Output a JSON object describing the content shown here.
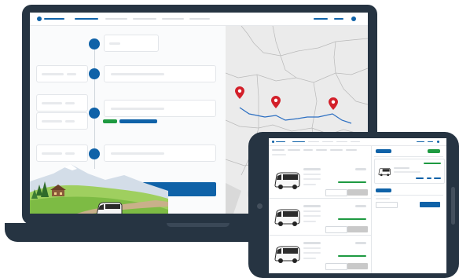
{
  "colors": {
    "accent": "#0f62a8",
    "success": "#1e9a41",
    "route_pin": "#d3202a",
    "route_line": "#2c6fc2",
    "device_frame": "#263442",
    "map_land": "#ebebeb"
  },
  "icons": [
    "logo-dot-icon",
    "user-icon",
    "map-pin-icon",
    "bus-icon"
  ],
  "laptop": {
    "timeline_stops": 4,
    "route_pins": 3
  },
  "tablet": {
    "result_rows": 3
  }
}
